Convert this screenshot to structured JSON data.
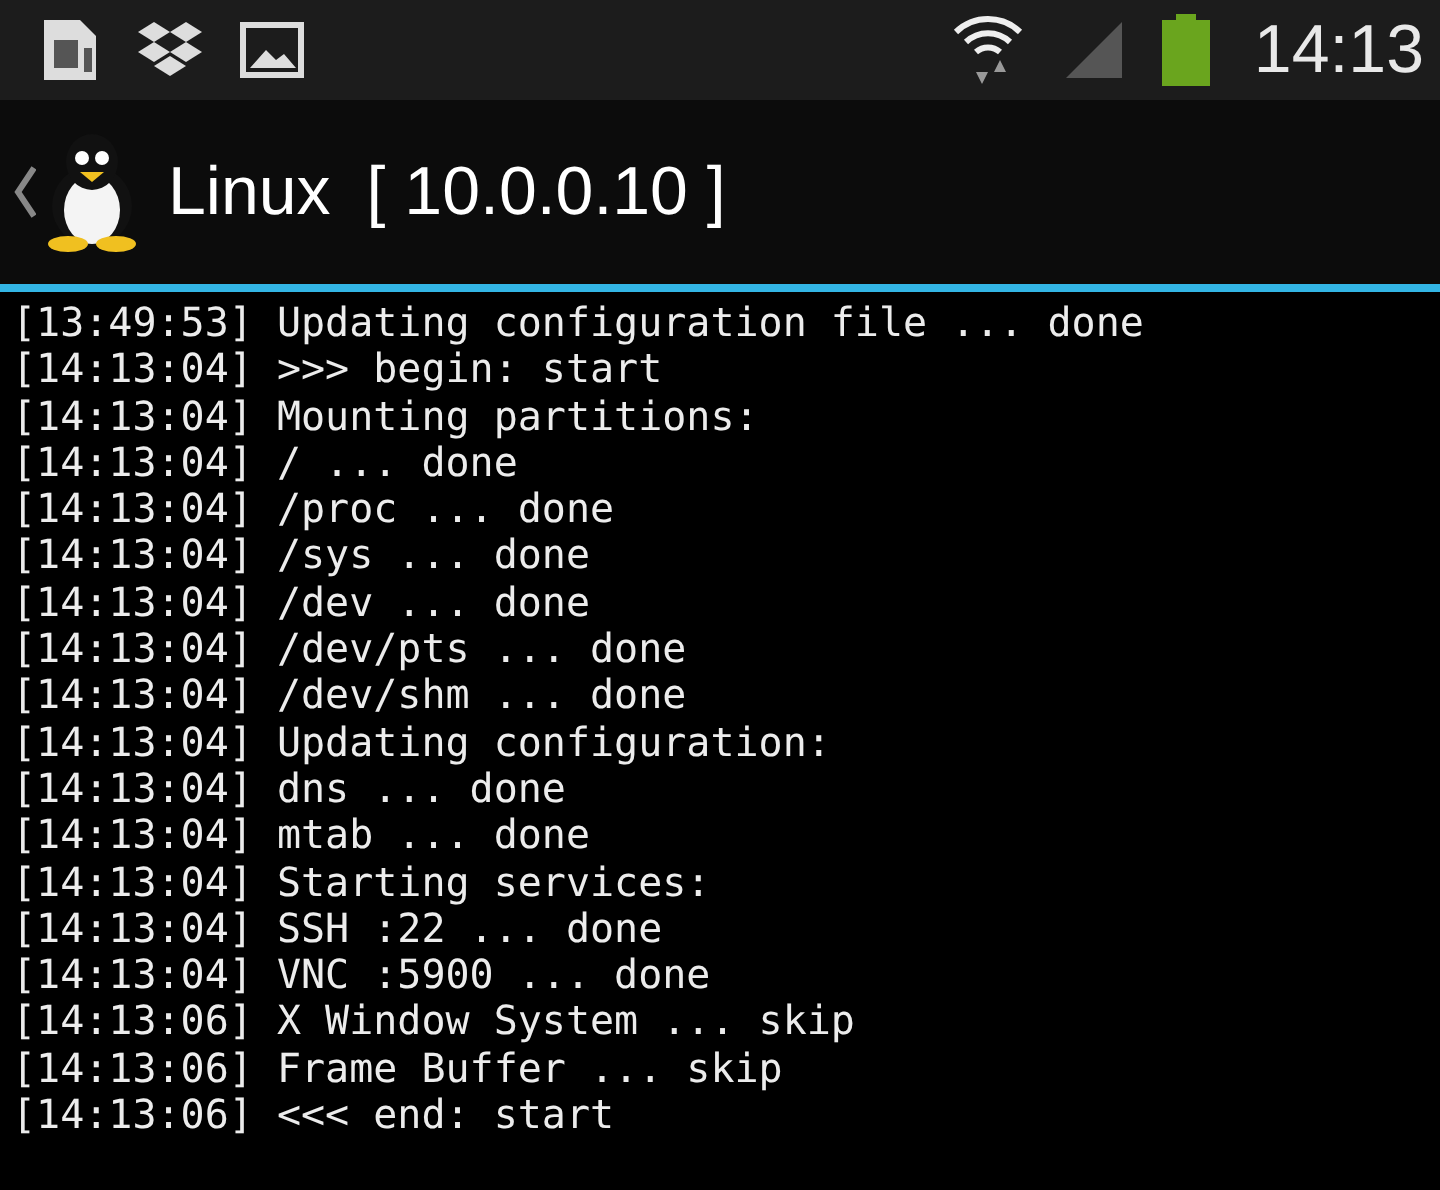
{
  "status_bar": {
    "time": "14:13"
  },
  "action_bar": {
    "title": "Linux",
    "subtitle": "[ 10.0.0.10 ]"
  },
  "log": [
    {
      "time": "[13:49:53]",
      "message": "Updating configuration file ... done"
    },
    {
      "time": "[14:13:04]",
      "message": ">>> begin: start"
    },
    {
      "time": "[14:13:04]",
      "message": "Mounting partitions:"
    },
    {
      "time": "[14:13:04]",
      "message": "/ ... done"
    },
    {
      "time": "[14:13:04]",
      "message": "/proc ... done"
    },
    {
      "time": "[14:13:04]",
      "message": "/sys ... done"
    },
    {
      "time": "[14:13:04]",
      "message": "/dev ... done"
    },
    {
      "time": "[14:13:04]",
      "message": "/dev/pts ... done"
    },
    {
      "time": "[14:13:04]",
      "message": "/dev/shm ... done"
    },
    {
      "time": "[14:13:04]",
      "message": "Updating configuration:"
    },
    {
      "time": "[14:13:04]",
      "message": "dns ... done"
    },
    {
      "time": "[14:13:04]",
      "message": "mtab ... done"
    },
    {
      "time": "[14:13:04]",
      "message": "Starting services:"
    },
    {
      "time": "[14:13:04]",
      "message": "SSH :22 ... done"
    },
    {
      "time": "[14:13:04]",
      "message": "VNC :5900 ... done"
    },
    {
      "time": "[14:13:06]",
      "message": "X Window System ... skip"
    },
    {
      "time": "[14:13:06]",
      "message": "Frame Buffer ... skip"
    },
    {
      "time": "[14:13:06]",
      "message": "<<< end: start"
    }
  ]
}
